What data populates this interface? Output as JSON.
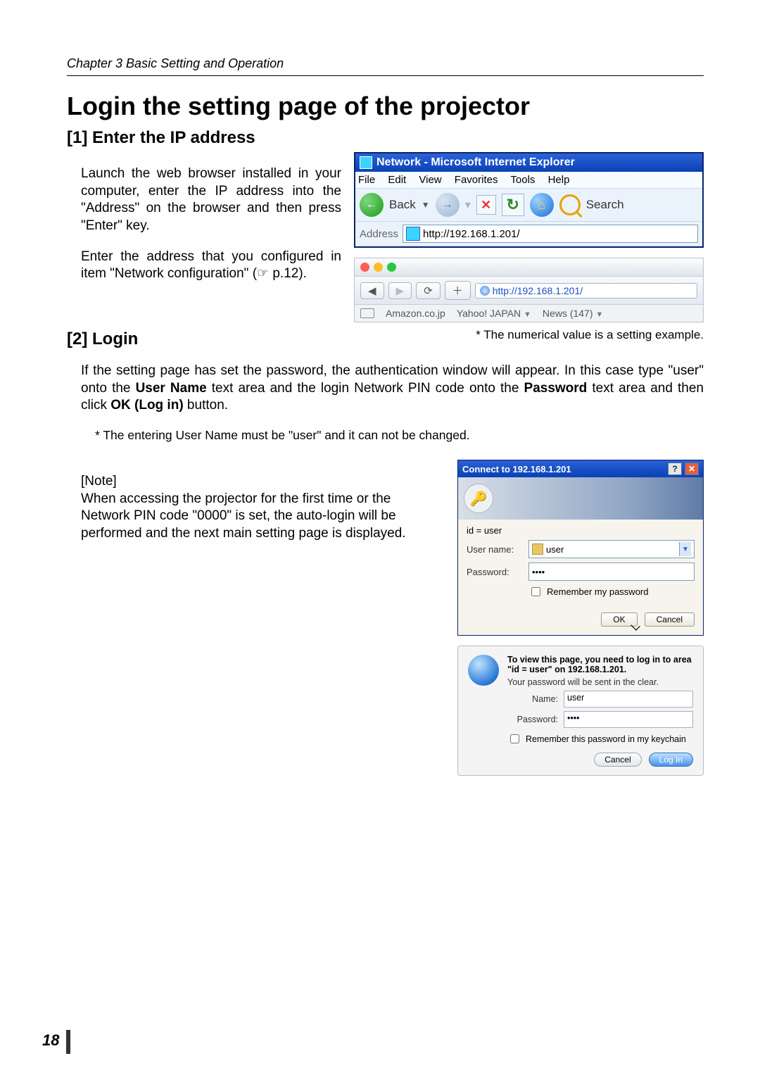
{
  "chapter_header": "Chapter 3 Basic Setting and Operation",
  "page_title": "Login the setting page of the projector",
  "page_number": "18",
  "section1": {
    "heading": "[1] Enter the IP address",
    "para1": "Launch the web browser installed in your computer, enter the IP address into the \"Address\" on the browser and then press \"Enter\" key.",
    "para2_pre": "Enter the address that you configured in item \"Network configuration\" (",
    "para2_ref": " p.12).",
    "ie": {
      "title": "Network - Microsoft Internet Explorer",
      "menu": {
        "file": "File",
        "edit": "Edit",
        "view": "View",
        "favorites": "Favorites",
        "tools": "Tools",
        "help": "Help"
      },
      "back_label": "Back",
      "search_label": "Search",
      "address_label": "Address",
      "url": "http://192.168.1.201/"
    },
    "safari": {
      "url": "http://192.168.1.201/",
      "bookmarks": {
        "amazon": "Amazon.co.jp",
        "yahoo": "Yahoo! JAPAN",
        "news": "News (147)"
      }
    },
    "caption": "* The numerical value is a setting example."
  },
  "section2": {
    "heading": "[2] Login",
    "para_parts": {
      "a": "If the setting page has set the password, the authentication window will appear. In this case type \"user\" onto the ",
      "b": "User Name",
      "c": " text area and the login Network PIN code onto the ",
      "d": "Password",
      "e": " text area and then click ",
      "f": "OK (Log in)",
      "g": " button."
    },
    "note_star": "* The entering User Name must be \"user\" and it can not be changed.",
    "note_label": "[Note]",
    "note_body": "When accessing the projector for the first time or the Network PIN code \"0000\" is set, the auto-login will be performed and the next main setting page is displayed.",
    "xp": {
      "title": "Connect to 192.168.1.201",
      "id_line": "id = user",
      "username_label": "User name:",
      "username_value": "user",
      "password_label": "Password:",
      "password_mask": "••••",
      "remember": "Remember my password",
      "ok": "OK",
      "cancel": "Cancel"
    },
    "mac": {
      "msg1": "To view this page, you need to log in to area \"id = user\" on 192.168.1.201.",
      "msg2": "Your password will be sent in the clear.",
      "name_label": "Name:",
      "name_value": "user",
      "password_label": "Password:",
      "password_mask": "••••",
      "remember": "Remember this password in my keychain",
      "cancel": "Cancel",
      "login": "Log In"
    }
  }
}
